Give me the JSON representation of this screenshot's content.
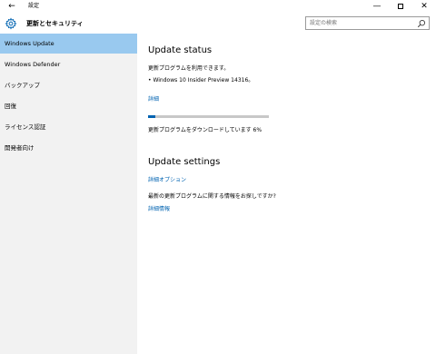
{
  "window": {
    "title": "設定",
    "back_icon": "back-arrow-icon",
    "minimize_icon": "minimize-icon",
    "maximize_icon": "maximize-icon",
    "close_icon": "close-icon"
  },
  "header": {
    "section_title": "更新とセキュリティ",
    "section_icon": "gear-icon"
  },
  "search": {
    "placeholder": "設定の検索",
    "icon": "search-icon"
  },
  "sidebar": {
    "items": [
      {
        "label": "Windows Update",
        "active": true
      },
      {
        "label": "Windows Defender",
        "active": false
      },
      {
        "label": "バックアップ",
        "active": false
      },
      {
        "label": "回復",
        "active": false
      },
      {
        "label": "ライセンス認証",
        "active": false
      },
      {
        "label": "開発者向け",
        "active": false
      }
    ]
  },
  "main": {
    "update_status": {
      "heading": "Update status",
      "available_text": "更新プログラムを利用できます。",
      "update_item": "• Windows 10 Insider Preview 14316。",
      "details_link": "詳細",
      "progress_percent": 6,
      "progress_text": "更新プログラムをダウンロードしています 6%"
    },
    "update_settings": {
      "heading": "Update settings",
      "advanced_options_link": "詳細オプション",
      "question_text": "最新の更新プログラムに関する情報をお探しですか?",
      "more_info_link": "詳細情報"
    }
  },
  "colors": {
    "accent": "#0063b1",
    "sidebar_bg": "#f2f2f2",
    "active_item_bg": "#99c9ef",
    "progress_track": "#c8c8c8"
  }
}
